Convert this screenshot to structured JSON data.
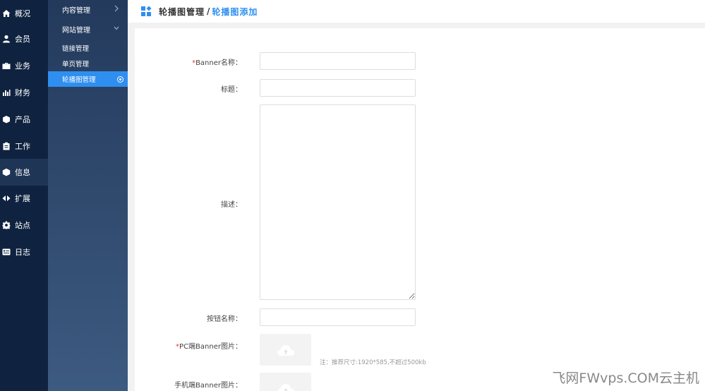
{
  "main_nav": {
    "items": [
      {
        "label": "概况",
        "icon": "home-icon"
      },
      {
        "label": "会员",
        "icon": "user-icon"
      },
      {
        "label": "业务",
        "icon": "briefcase-icon"
      },
      {
        "label": "财务",
        "icon": "bar-chart-icon"
      },
      {
        "label": "产品",
        "icon": "box-icon"
      },
      {
        "label": "工作",
        "icon": "clipboard-icon"
      },
      {
        "label": "信息",
        "icon": "cube-icon"
      },
      {
        "label": "扩展",
        "icon": "expand-arrows-icon"
      },
      {
        "label": "站点",
        "icon": "gear-icon"
      },
      {
        "label": "日志",
        "icon": "log-card-icon"
      }
    ],
    "active_index": 6
  },
  "sub_nav": {
    "groups": [
      {
        "label": "内容管理"
      },
      {
        "label": "网站管理"
      }
    ],
    "items": [
      {
        "label": "链接管理"
      },
      {
        "label": "单页管理"
      },
      {
        "label": "轮播图管理"
      }
    ],
    "active_item": 2
  },
  "header": {
    "crumb_parent": "轮播图管理",
    "separator": "/",
    "crumb_current": "轮播图添加",
    "accent_color": "#2f8ff0"
  },
  "form": {
    "required_mark": "*",
    "banner_name_label": "Banner名称：",
    "title_label": "标题：",
    "desc_label": "描述：",
    "button_name_label": "按钮名称：",
    "pc_image_label": "PC端Banner图片：",
    "pc_image_hint": "注：推荐尺寸:1920*585,不超过500kb",
    "mobile_image_label": "手机端Banner图片："
  },
  "watermark": "飞网FWvps.COM云主机"
}
